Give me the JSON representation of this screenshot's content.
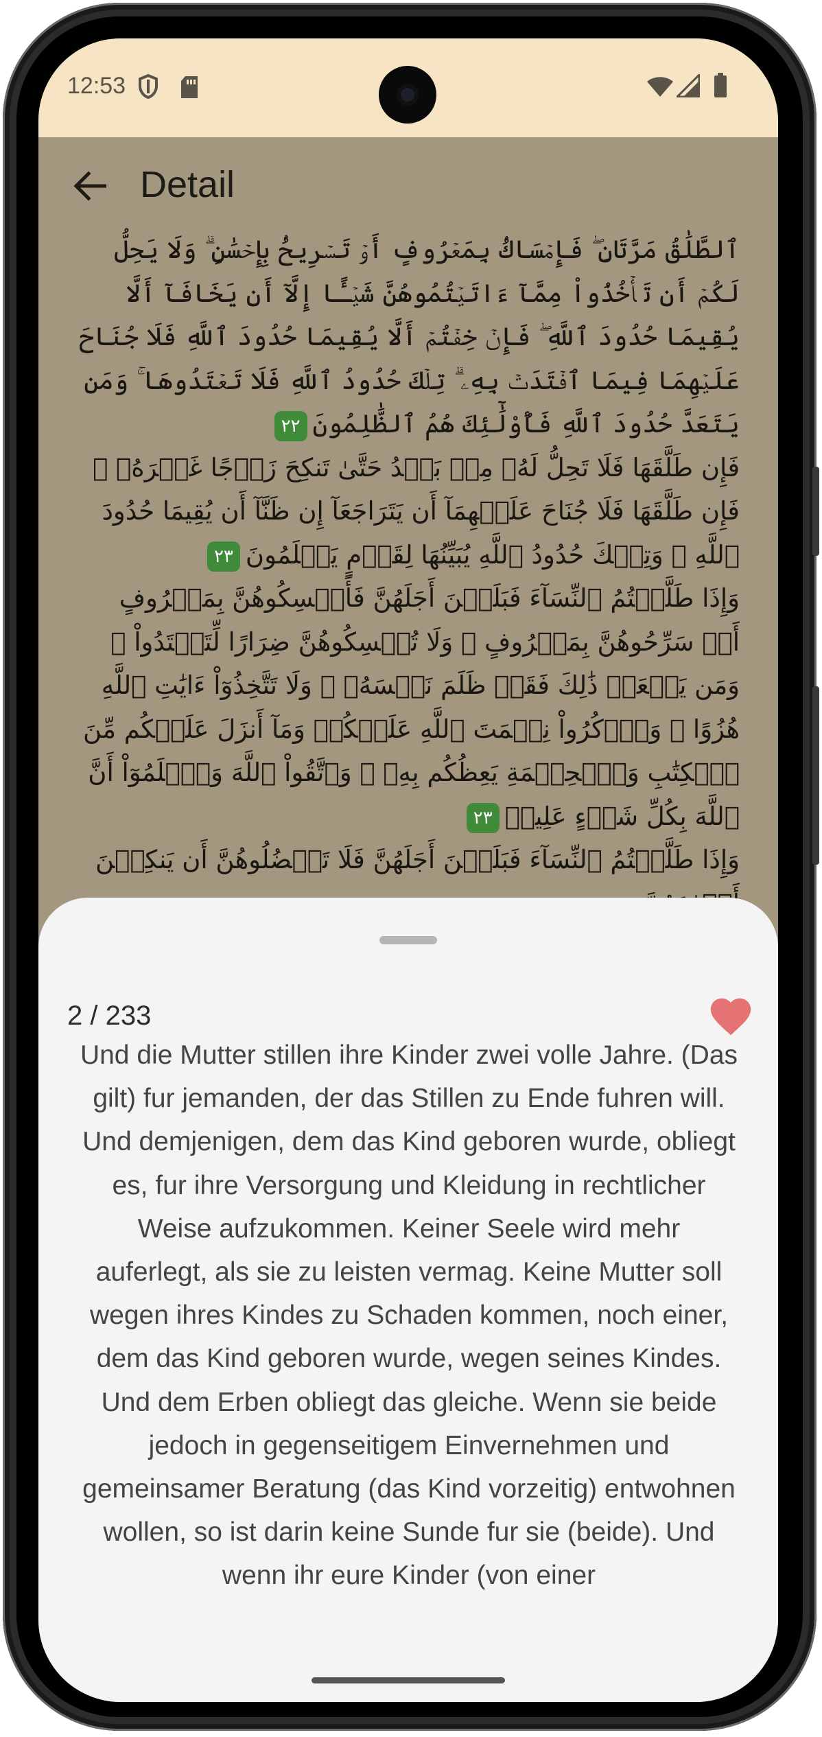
{
  "status_bar": {
    "time": "12:53",
    "left_icons": [
      "shield-icon",
      "sd-card-icon"
    ],
    "right_icons": [
      "wifi-icon",
      "cell-signal-icon",
      "battery-icon"
    ]
  },
  "app_bar": {
    "back_icon": "arrow-back-icon",
    "title": "Detail"
  },
  "colors": {
    "status_bar_bg": "#f6e4c5",
    "content_bg": "#a39780",
    "ayah_badge": "#3f8b3a",
    "sheet_bg": "#f4f4f4",
    "favorite": "#e57373"
  },
  "arabic_verses": [
    {
      "text": "ٱلطَّلَٰقُ مَرَّتَانِ ۖ فَإِمۡسَاكُۢ بِمَعۡرُوفٍ أَوۡ تَسۡرِيحُۢ بِإِحۡسَٰنٍ ۗ وَلَا يَحِلُّ لَكُمۡ أَن تَأۡخُذُواْ مِمَّآ ءَاتَيۡتُمُوهُنَّ شَيۡـًٔا إِلَّآ أَن يَخَافَآ أَلَّا يُقِيمَا حُدُودَ ٱللَّهِ ۖ فَإِنۡ خِفۡتُمۡ أَلَّا يُقِيمَا حُدُودَ ٱللَّهِ فَلَا جُنَاحَ عَلَيۡهِمَا فِيمَا ٱفۡتَدَتۡ بِهِۦ ۗ تِلۡكَ حُدُودُ ٱللَّهِ فَلَا تَعۡتَدُوهَا ۚ وَمَن يَتَعَدَّ حُدُودَ ٱللَّهِ فَأُوْلَٰٓئِكَ هُمُ ٱلظَّٰلِمُونَ",
      "number": "٢٢"
    },
    {
      "text": "فَإِن طَلَّقَهَا فَلَا تَحِلُّ لَهُۥ مِنۢ بَعۡدُ حَتَّىٰ تَنكِحَ زَوۡجًا غَيۡرَهُۥ ۗ فَإِن طَلَّقَهَا فَلَا جُنَاحَ عَلَيۡهِمَآ أَن يَتَرَاجَعَآ إِن ظَنَّآ أَن يُقِيمَا حُدُودَ ٱللَّهِ ۗ وَتِلۡكَ حُدُودُ ٱللَّهِ يُبَيِّنُهَا لِقَوۡمٍ يَعۡلَمُونَ",
      "number": "٢٣"
    },
    {
      "text": "وَإِذَا طَلَّقۡتُمُ ٱلنِّسَآءَ فَبَلَغۡنَ أَجَلَهُنَّ فَأَمۡسِكُوهُنَّ بِمَعۡرُوفٍ أَوۡ سَرِّحُوهُنَّ بِمَعۡرُوفٍ ۚ وَلَا تُمۡسِكُوهُنَّ ضِرَارًا لِّتَعۡتَدُواْ ۚ وَمَن يَفۡعَلۡ ذَٰلِكَ فَقَدۡ ظَلَمَ نَفۡسَهُۥ ۚ وَلَا تَتَّخِذُوٓاْ ءَايَٰتِ ٱللَّهِ هُزُوًا ۚ وَٱذۡكُرُواْ نِعۡمَتَ ٱللَّهِ عَلَيۡكُمۡ وَمَآ أَنزَلَ عَلَيۡكُم مِّنَ ٱلۡكِتَٰبِ وَٱلۡحِكۡمَةِ يَعِظُكُم بِهِۦ ۚ وَٱتَّقُواْ ٱللَّهَ وَٱعۡلَمُوٓاْ أَنَّ ٱللَّهَ بِكُلِّ شَيۡءٍ عَلِيمٞ",
      "number": "٢٣"
    },
    {
      "text": "وَإِذَا طَلَّقۡتُمُ ٱلنِّسَآءَ فَبَلَغۡنَ أَجَلَهُنَّ فَلَا تَعۡضُلُوهُنَّ أَن يَنكِحۡنَ أَزۡوَٰجَهُنَّ",
      "number": ""
    }
  ],
  "sheet": {
    "counter": "2 / 233",
    "favorite_icon": "heart-icon",
    "translation": "Und die Mutter stillen ihre Kinder zwei volle Jahre. (Das gilt) fur jemanden, der das Stillen zu Ende fuhren will. Und demjenigen, dem das Kind geboren wurde, obliegt es, fur ihre Versorgung und Kleidung in rechtlicher Weise aufzukommen. Keiner Seele wird mehr auferlegt, als sie zu leisten vermag. Keine Mutter soll wegen ihres Kindes zu Schaden kommen, noch einer, dem das Kind geboren wurde, wegen seines Kindes. Und dem Erben obliegt das gleiche. Wenn sie beide jedoch in gegenseitigem Einvernehmen und gemeinsamer Beratung (das Kind vorzeitig) entwohnen wollen, so ist darin keine Sunde fur sie (beide). Und wenn ihr eure Kinder (von einer"
  }
}
